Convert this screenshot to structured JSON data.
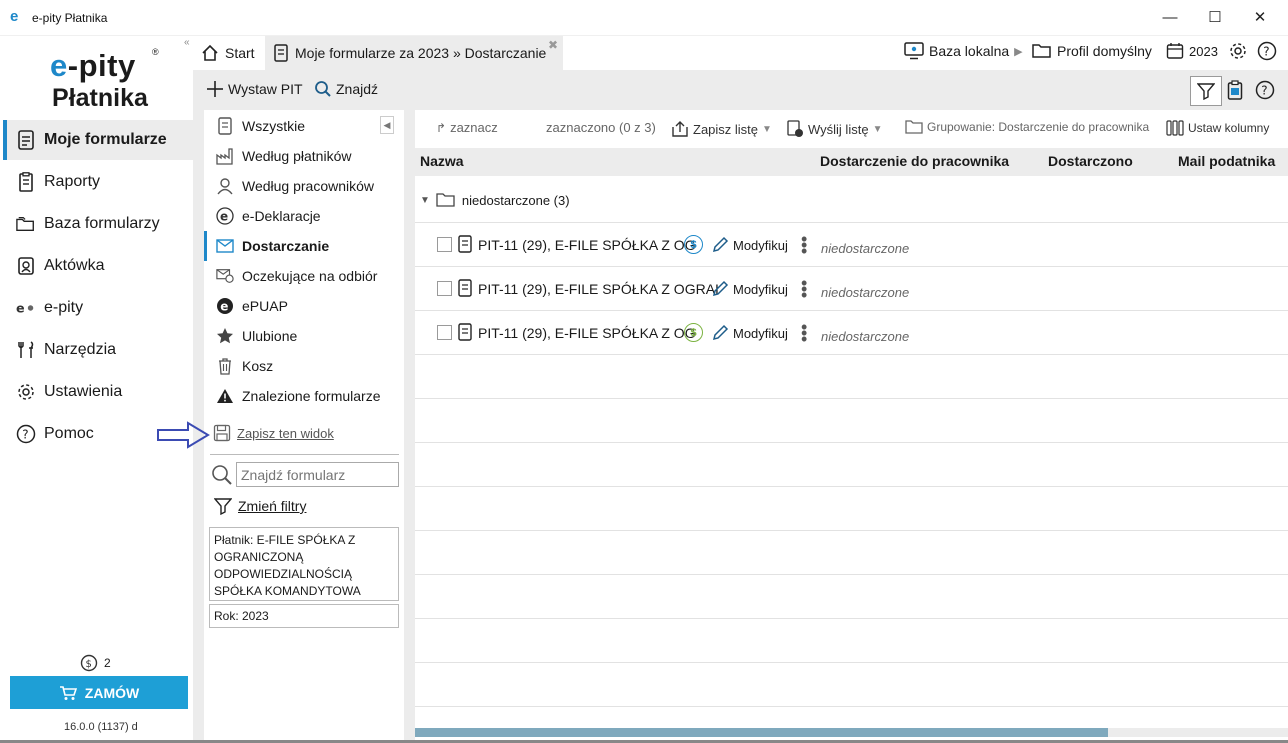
{
  "window": {
    "title": "e-pity Płatnika",
    "logo_mini": "e",
    "minimize": "—",
    "maximize": "☐",
    "close": "✕"
  },
  "brand": {
    "line1_e": "e",
    "line1_rest": "-pity",
    "reg": "®",
    "line2": "Płatnika"
  },
  "sidebar": {
    "items": [
      {
        "label": "Moje formularze",
        "icon": "form-icon",
        "active": true
      },
      {
        "label": "Raporty",
        "icon": "report-icon"
      },
      {
        "label": "Baza formularzy",
        "icon": "folders-icon"
      },
      {
        "label": "Aktówka",
        "icon": "briefcase-icon"
      },
      {
        "label": "e-pity",
        "icon": "epity-icon"
      },
      {
        "label": "Narzędzia",
        "icon": "tools-icon"
      },
      {
        "label": "Ustawienia",
        "icon": "gear-icon"
      },
      {
        "label": "Pomoc",
        "icon": "help-icon"
      }
    ],
    "coins": "2",
    "order_label": "ZAMÓW",
    "version": "16.0.0 (1137) d",
    "collapse": "«"
  },
  "tabs": [
    {
      "label": "Start",
      "icon": "home-icon"
    },
    {
      "label": "Moje formularze za 2023 » Dostarczanie",
      "icon": "form-icon",
      "active": true
    }
  ],
  "tab_close": "✖",
  "topbar": {
    "db_label": "Baza lokalna",
    "profile_label": "Profil domyślny",
    "year": "2023"
  },
  "toolbar": {
    "issue_pit": "Wystaw PIT",
    "find": "Znajdź"
  },
  "mid": {
    "items": [
      {
        "label": "Wszystkie",
        "icon": "form-icon"
      },
      {
        "label": "Według płatników",
        "icon": "factory-icon"
      },
      {
        "label": "Według pracowników",
        "icon": "person-icon"
      },
      {
        "label": "e-Deklaracje",
        "icon": "edeklaracje-icon"
      },
      {
        "label": "Dostarczanie",
        "icon": "mail-icon",
        "active": true
      },
      {
        "label": "Oczekujące na odbiór",
        "icon": "pending-mail-icon"
      },
      {
        "label": "ePUAP",
        "icon": "epuap-icon"
      },
      {
        "label": "Ulubione",
        "icon": "star-icon"
      },
      {
        "label": "Kosz",
        "icon": "trash-icon"
      },
      {
        "label": "Znalezione formularze",
        "icon": "warning-icon"
      }
    ],
    "save_view": "Zapisz ten widok",
    "search_placeholder": "Znajdź formularz",
    "change_filters": "Zmień filtry",
    "filter_payer": "Płatnik: E-FILE SPÓŁKA Z OGRANICZONĄ ODPOWIEDZIALNOŚCIĄ SPÓŁKA KOMANDYTOWA",
    "filter_year": "Rok: 2023",
    "collapse": "◀"
  },
  "grid_toolbar": {
    "select": "zaznacz",
    "selected": "zaznaczono (0 z 3)",
    "save_list": "Zapisz listę",
    "send_list": "Wyślij listę",
    "grouping": "Grupowanie: Dostarczenie do pracownika",
    "set_columns": "Ustaw kolumny"
  },
  "grid": {
    "columns": [
      "Nazwa",
      "Dostarczenie do pracownika",
      "Dostarczono",
      "Mail podatnika"
    ],
    "group_label": "niedostarczone (3)",
    "rows": [
      {
        "name": "PIT-11 (29), E-FILE SPÓŁKA Z OG",
        "coin": "$",
        "coin_color": "#1e88c9",
        "edit": "Modyfikuj",
        "status": "niedostarczone"
      },
      {
        "name": "PIT-11 (29), E-FILE SPÓŁKA Z OGRAI",
        "coin": "",
        "coin_color": "",
        "edit": "Modyfikuj",
        "status": "niedostarczone"
      },
      {
        "name": "PIT-11 (29), E-FILE SPÓŁKA Z OG",
        "coin": "$",
        "coin_color": "#7cb342",
        "edit": "Modyfikuj",
        "status": "niedostarczone"
      }
    ]
  },
  "colors": {
    "accent": "#1e88c9",
    "order_button": "#1e9fd6",
    "panel_gray": "#ececec"
  }
}
